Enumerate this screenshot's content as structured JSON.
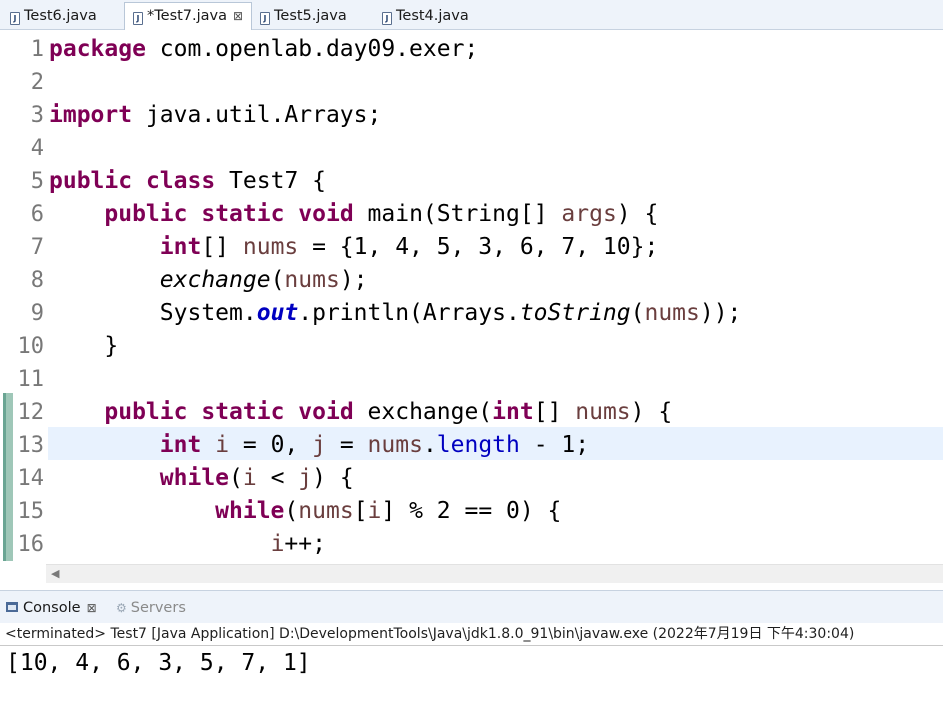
{
  "editor_tabs": [
    {
      "label": "Test6.java",
      "active": false
    },
    {
      "label": "*Test7.java",
      "active": true
    },
    {
      "label": "Test5.java",
      "active": false
    },
    {
      "label": "Test4.java",
      "active": false
    }
  ],
  "line_numbers": [
    "1",
    "2",
    "3",
    "4",
    "5",
    "6",
    "7",
    "8",
    "9",
    "10",
    "11",
    "12",
    "13",
    "14",
    "15",
    "16"
  ],
  "code": {
    "l1": {
      "kw": "package",
      "rest": " com.openlab.day09.exer;"
    },
    "l3": {
      "kw": "import",
      "rest": " java.util.Arrays;"
    },
    "l5": {
      "kw1": "public",
      "kw2": "class",
      "rest": " Test7 {"
    },
    "l6": {
      "indent": "    ",
      "kw1": "public",
      "kw2": "static",
      "kw3": "void",
      "name": " main(String[] ",
      "param": "args",
      "rest": ") {"
    },
    "l7": {
      "indent": "        ",
      "kw": "int",
      "mid": "[] ",
      "var": "nums",
      "rest": " = {1, 4, 5, 3, 6, 7, 10};"
    },
    "l8": {
      "indent": "        ",
      "method": "exchange",
      "open": "(",
      "var": "nums",
      "rest": ");"
    },
    "l9": {
      "indent": "        ",
      "a": "System.",
      "field": "out",
      "b": ".println(Arrays.",
      "method": "toString",
      "c": "(",
      "var": "nums",
      "d": "));"
    },
    "l10": {
      "indent": "    ",
      "rest": "}"
    },
    "l12": {
      "indent": "    ",
      "kw1": "public",
      "kw2": "static",
      "kw3": "void",
      "name": " exchange(",
      "kw4": "int",
      "mid": "[] ",
      "param": "nums",
      "rest": ") {"
    },
    "l13": {
      "indent": "        ",
      "kw": "int",
      "sp": " ",
      "v1": "i",
      "a": " = 0, ",
      "v2": "j",
      "b": " = ",
      "v3": "nums",
      "dot": ".",
      "field": "length",
      "c": " - 1;"
    },
    "l14": {
      "indent": "        ",
      "kw": "while",
      "a": "(",
      "v1": "i",
      "b": " < ",
      "v2": "j",
      "c": ") {"
    },
    "l15": {
      "indent": "            ",
      "kw": "while",
      "a": "(",
      "v1": "nums",
      "b": "[",
      "v2": "i",
      "c": "] % 2 == 0) {"
    },
    "l16": {
      "indent": "                ",
      "v1": "i",
      "rest": "++;"
    }
  },
  "scrollbar": {
    "left_arrow": "◀"
  },
  "console": {
    "tabs": [
      {
        "label": "Console",
        "active": true
      },
      {
        "label": "Servers",
        "active": false
      }
    ],
    "close_glyph": "⊠",
    "status": "<terminated> Test7 [Java Application] D:\\DevelopmentTools\\Java\\jdk1.8.0_91\\bin\\javaw.exe (2022年7月19日 下午4:30:04)",
    "output": "[10, 4, 6, 3, 5, 7, 1]"
  },
  "icons": {
    "java_file": "J",
    "servers": "⚙"
  },
  "colors": {
    "keyword": "#7f0055",
    "variable": "#6a3e3e",
    "field": "#0000c0",
    "current_line": "#e8f2fe"
  }
}
